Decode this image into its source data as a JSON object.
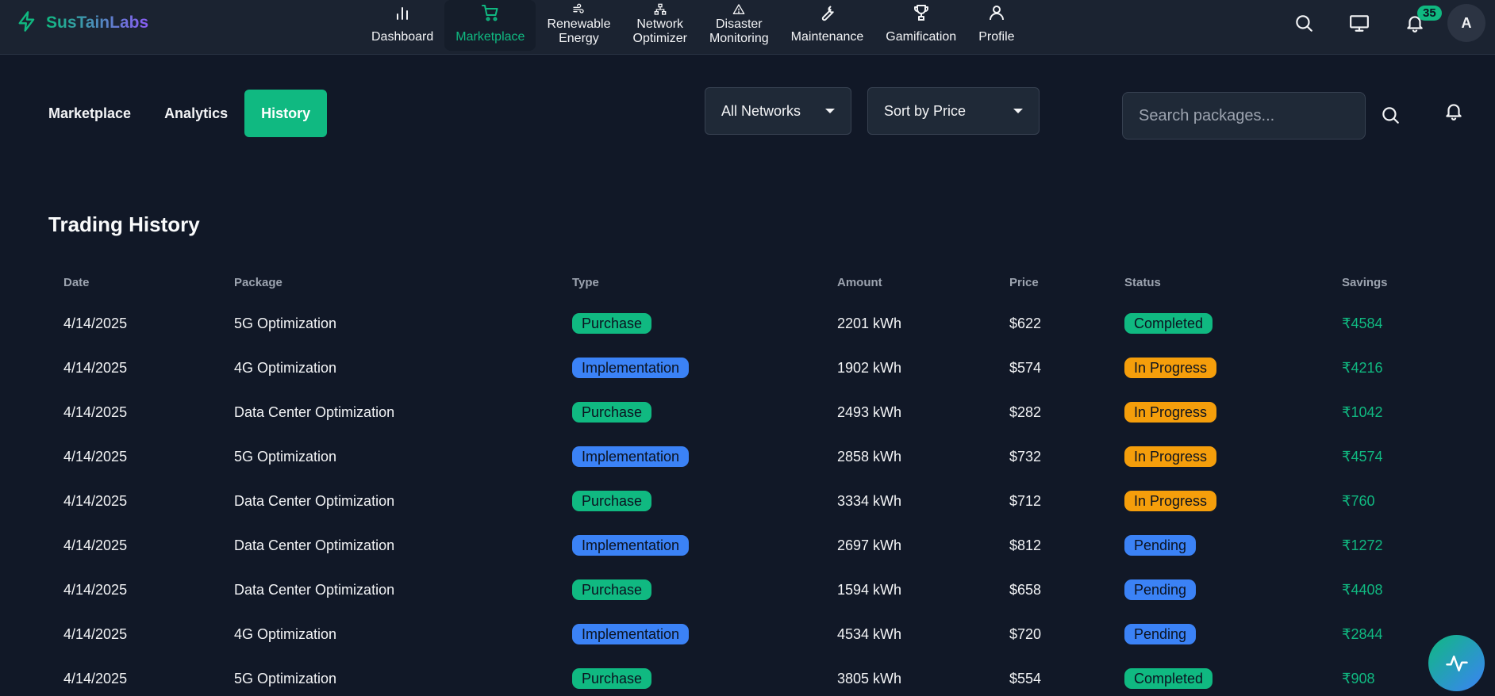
{
  "brand": {
    "name": "SusTainLabs",
    "icon": "lightning-icon"
  },
  "nav": {
    "items": [
      {
        "label": "Dashboard",
        "icon": "bar-chart-icon",
        "active": false
      },
      {
        "label": "Marketplace",
        "icon": "cart-icon",
        "active": true
      },
      {
        "label": "Renewable\nEnergy",
        "line1": "Renewable",
        "line2": "Energy",
        "icon": "wind-icon",
        "active": false
      },
      {
        "label": "Network\nOptimizer",
        "line1": "Network",
        "line2": "Optimizer",
        "icon": "network-icon",
        "active": false
      },
      {
        "label": "Disaster\nMonitoring",
        "line1": "Disaster",
        "line2": "Monitoring",
        "icon": "alert-triangle-icon",
        "active": false
      },
      {
        "label": "Maintenance",
        "icon": "wrench-icon",
        "active": false
      },
      {
        "label": "Gamification",
        "icon": "trophy-icon",
        "active": false
      },
      {
        "label": "Profile",
        "icon": "user-icon",
        "active": false
      }
    ],
    "notification_count": "35",
    "avatar_initial": "A"
  },
  "subtabs": [
    {
      "label": "Marketplace",
      "active": false
    },
    {
      "label": "Analytics",
      "active": false
    },
    {
      "label": "History",
      "active": true
    }
  ],
  "filters": {
    "network": "All Networks",
    "sort": "Sort by Price",
    "search_placeholder": "Search packages..."
  },
  "history": {
    "title": "Trading History",
    "columns": [
      "Date",
      "Package",
      "Type",
      "Amount",
      "Price",
      "Status",
      "Savings"
    ],
    "rows": [
      {
        "date": "4/14/2025",
        "package": "5G Optimization",
        "type": "Purchase",
        "amount": "2201 kWh",
        "price": "$622",
        "status": "Completed",
        "savings": "₹4584"
      },
      {
        "date": "4/14/2025",
        "package": "4G Optimization",
        "type": "Implementation",
        "amount": "1902 kWh",
        "price": "$574",
        "status": "In Progress",
        "savings": "₹4216"
      },
      {
        "date": "4/14/2025",
        "package": "Data Center Optimization",
        "type": "Purchase",
        "amount": "2493 kWh",
        "price": "$282",
        "status": "In Progress",
        "savings": "₹1042"
      },
      {
        "date": "4/14/2025",
        "package": "5G Optimization",
        "type": "Implementation",
        "amount": "2858 kWh",
        "price": "$732",
        "status": "In Progress",
        "savings": "₹4574"
      },
      {
        "date": "4/14/2025",
        "package": "Data Center Optimization",
        "type": "Purchase",
        "amount": "3334 kWh",
        "price": "$712",
        "status": "In Progress",
        "savings": "₹760"
      },
      {
        "date": "4/14/2025",
        "package": "Data Center Optimization",
        "type": "Implementation",
        "amount": "2697 kWh",
        "price": "$812",
        "status": "Pending",
        "savings": "₹1272"
      },
      {
        "date": "4/14/2025",
        "package": "Data Center Optimization",
        "type": "Purchase",
        "amount": "1594 kWh",
        "price": "$658",
        "status": "Pending",
        "savings": "₹4408"
      },
      {
        "date": "4/14/2025",
        "package": "4G Optimization",
        "type": "Implementation",
        "amount": "4534 kWh",
        "price": "$720",
        "status": "Pending",
        "savings": "₹2844"
      },
      {
        "date": "4/14/2025",
        "package": "5G Optimization",
        "type": "Purchase",
        "amount": "3805 kWh",
        "price": "$554",
        "status": "Completed",
        "savings": "₹908"
      }
    ]
  },
  "colors": {
    "background": "#111827",
    "navbar": "#1b2331",
    "accent": "#10b981",
    "purchase": "#10b981",
    "implementation": "#3b82f6",
    "completed": "#10b981",
    "in_progress": "#f59e0b",
    "pending": "#3b82f6"
  },
  "fab_icon": "activity-icon"
}
